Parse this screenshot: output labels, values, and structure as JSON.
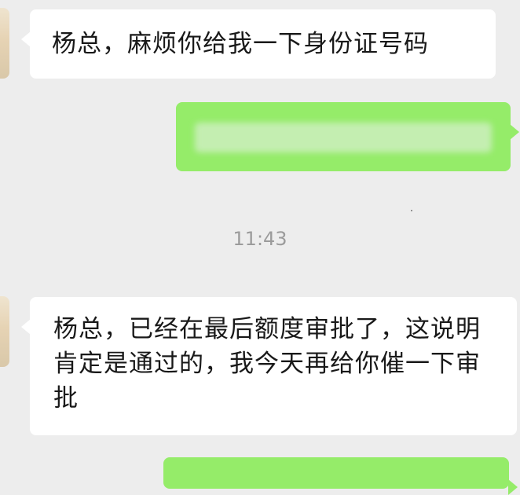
{
  "messages": [
    {
      "direction": "incoming",
      "text": "杨总，麻烦你给我一下身份证号码"
    },
    {
      "direction": "outgoing",
      "text": ""
    },
    {
      "direction": "incoming",
      "text": "杨总，已经在最后额度审批了，这说明肯定是通过的，我今天再给你催一下审批"
    }
  ],
  "timestamp": "11:43",
  "colors": {
    "background": "#ededed",
    "incoming_bubble": "#ffffff",
    "outgoing_bubble": "#95ec69",
    "timestamp_text": "#9b9b9b"
  }
}
